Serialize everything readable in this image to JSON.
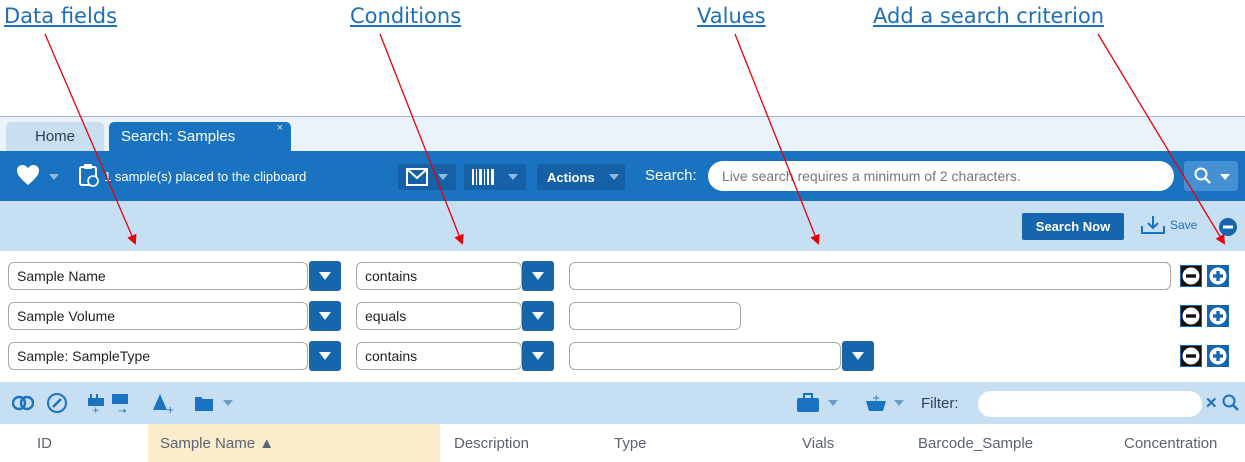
{
  "annotations": {
    "data_fields": "Data fields",
    "conditions": "Conditions",
    "values": "Values",
    "add_criterion": "Add a search criterion"
  },
  "tabs": [
    {
      "label": "Home"
    },
    {
      "label": "Search: Samples",
      "close": "×"
    }
  ],
  "toolbar": {
    "clipboard_text": "1 sample(s) placed to the clipboard",
    "actions_label": "Actions",
    "search_label": "Search:",
    "search_placeholder": "Live search requires a minimum of 2 characters."
  },
  "actionbar": {
    "search_now": "Search Now",
    "save": "Save"
  },
  "criteria": [
    {
      "field": "Sample Name",
      "condition": "contains",
      "value": ""
    },
    {
      "field": "Sample Volume",
      "condition": "equals",
      "value": ""
    },
    {
      "field": "Sample: SampleType",
      "condition": "contains",
      "value": ""
    }
  ],
  "gridbar": {
    "filter_label": "Filter:",
    "filter_value": ""
  },
  "columns": [
    "ID",
    "Sample Name ▲",
    "Description",
    "Type",
    "Vials",
    "Barcode_Sample",
    "Concentration"
  ],
  "colors": {
    "accent": "#1a73c0",
    "button_dark": "#1566ad",
    "light_band": "#c7dff3",
    "annotation_link": "#1f6fb8",
    "arrow": "#e8000b",
    "sorted_column": "#fbeccc"
  }
}
